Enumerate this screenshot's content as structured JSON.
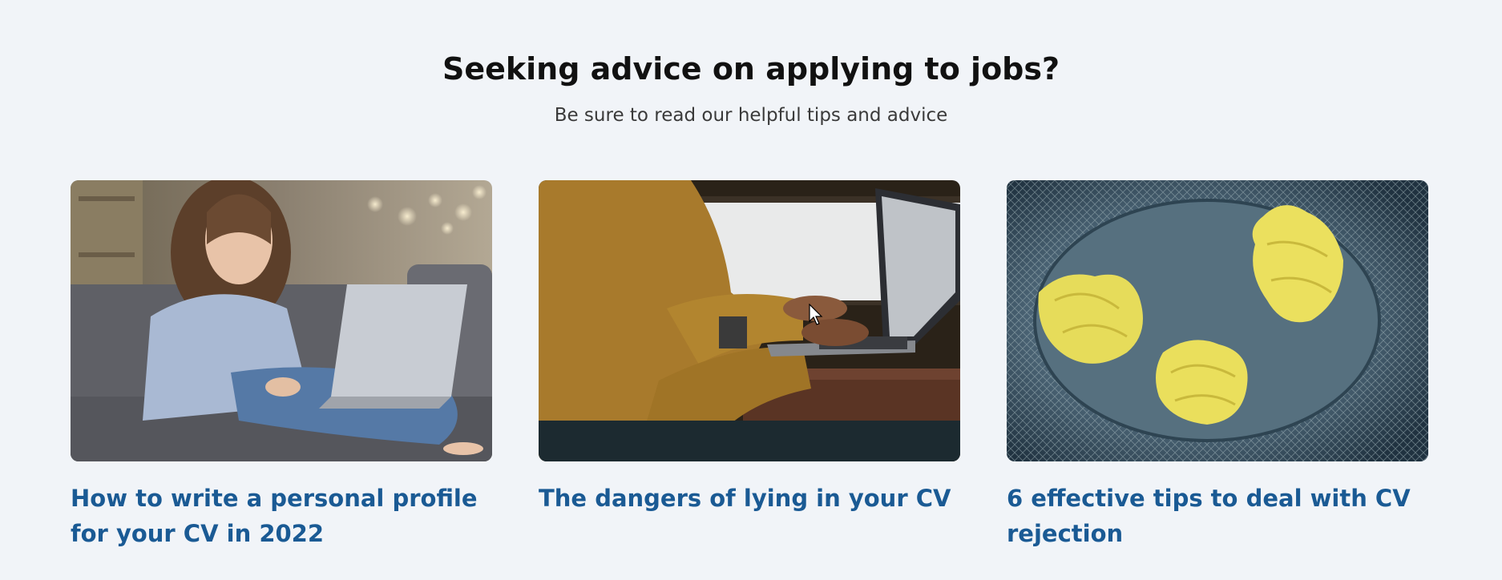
{
  "section": {
    "heading": "Seeking advice on applying to jobs?",
    "subheading": "Be sure to read our helpful tips and advice"
  },
  "articles": [
    {
      "title": "How to write a personal profile for your CV in 2022",
      "image": "woman-on-sofa-with-laptop-photo"
    },
    {
      "title": "The dangers of lying in your CV",
      "image": "hands-typing-on-laptop-photo"
    },
    {
      "title": "6 effective tips to deal with CV rejection",
      "image": "crumpled-paper-in-bin-photo"
    }
  ],
  "colors": {
    "background": "#f1f4f8",
    "heading": "#111111",
    "link": "#1a5a94"
  }
}
